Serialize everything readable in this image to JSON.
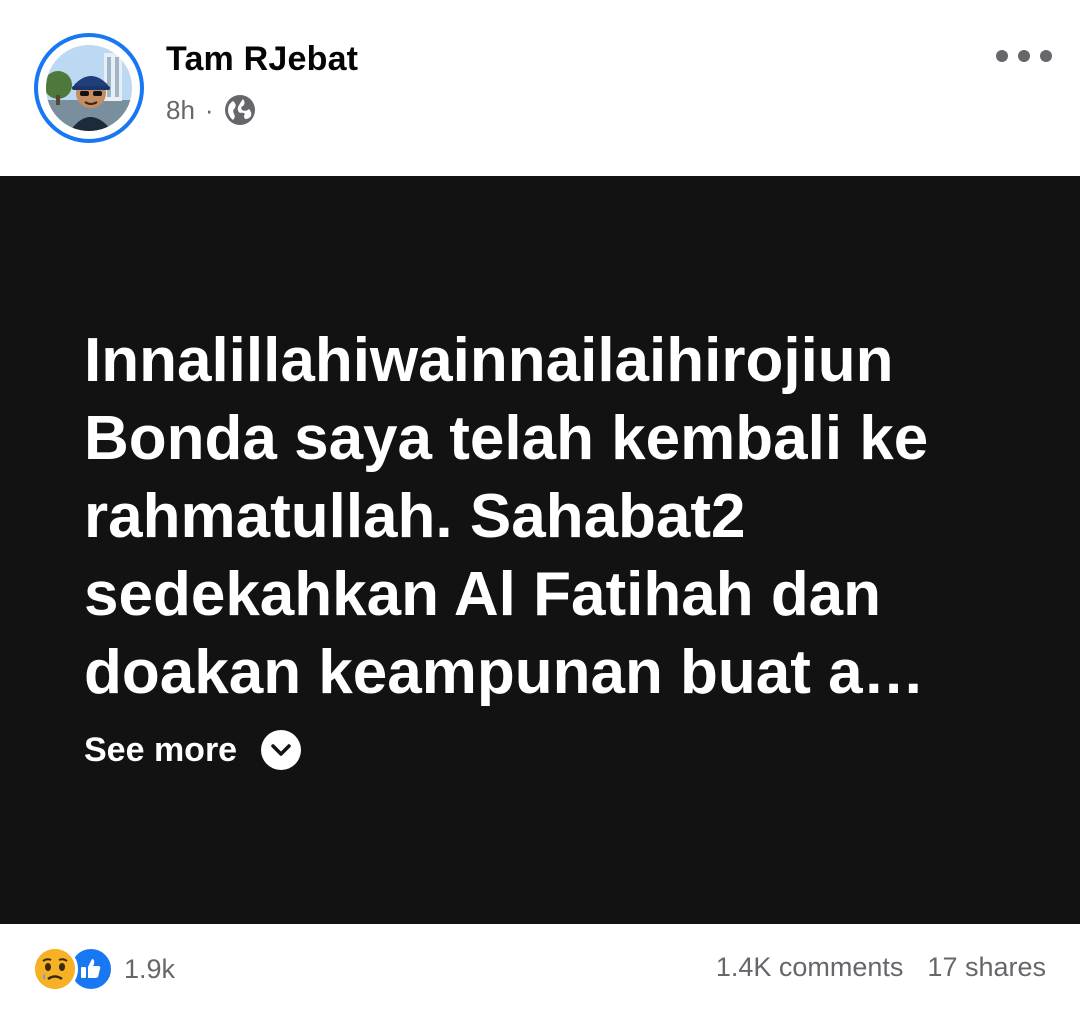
{
  "post": {
    "author": "Tam RJebat",
    "time": "8h",
    "separator": "·",
    "privacy_icon": "globe-icon",
    "more_icon": "more-horizontal-icon",
    "text": "Innalillahiwainnailaihirojiun\nBonda saya telah kembali ke\nrahmatullah. Sahabat2\nsedekahkan Al Fatihah dan\ndoakan keampunan buat a…",
    "see_more_label": "See more",
    "see_more_icon": "chevron-down-icon",
    "card_background": "#121212"
  },
  "footer": {
    "reaction_icons": [
      "sad-reaction-icon",
      "like-reaction-icon"
    ],
    "reaction_count": "1.9k",
    "comments": "1.4K comments",
    "shares": "17 shares"
  },
  "colors": {
    "accent": "#1877f2",
    "text_primary": "#050505",
    "text_secondary": "#65676b",
    "sad_yellow": "#f7b125"
  }
}
